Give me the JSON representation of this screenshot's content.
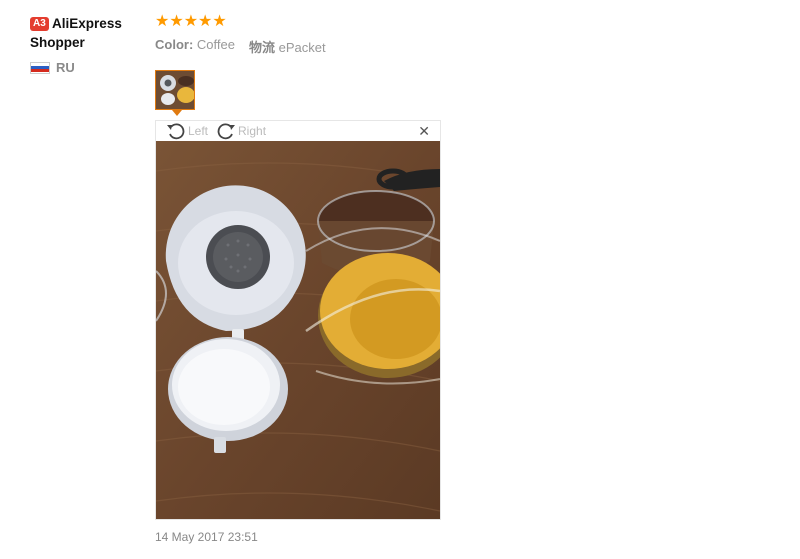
{
  "user": {
    "badge": "A3",
    "name": "AliExpress Shopper",
    "country": "RU",
    "flag_colors": [
      "#ffffff",
      "#2b5fc4",
      "#d52b1e"
    ]
  },
  "review": {
    "stars": "★★★★★",
    "rating": 5,
    "color_label": "Color:",
    "color_value": "Coffee",
    "shipping_label": "物流",
    "shipping_value": "ePacket",
    "date": "14 May 2017 23:51"
  },
  "viewer": {
    "left_label": "Left",
    "right_label": "Right",
    "close_glyph": "✕"
  },
  "colors": {
    "accent": "#e07a10",
    "star": "#ff9a00",
    "badge": "#e43d2f"
  },
  "icons": [
    "rotate-left-icon",
    "rotate-right-icon",
    "close-icon"
  ]
}
